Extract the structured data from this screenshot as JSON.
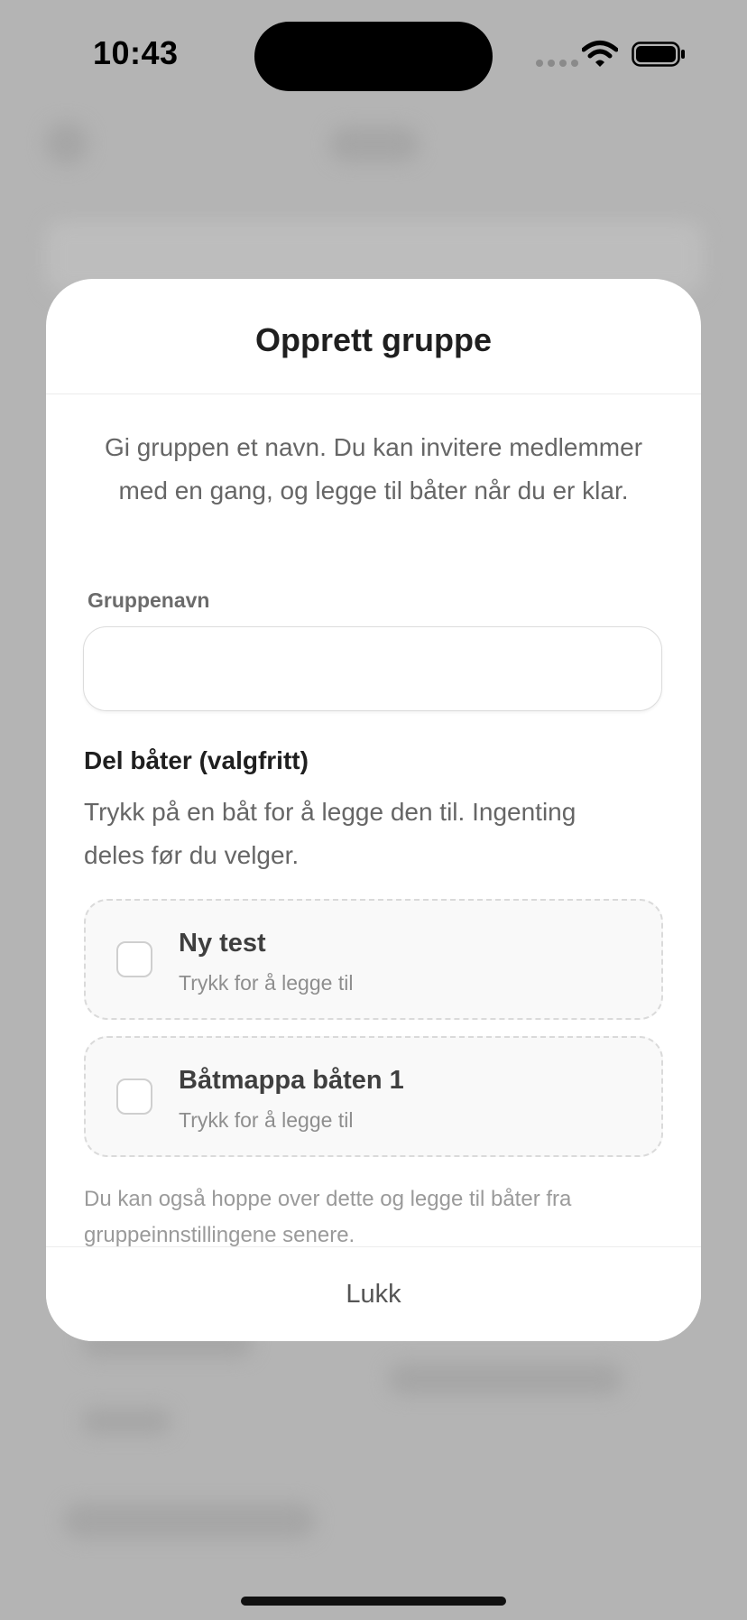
{
  "status_bar": {
    "time": "10:43"
  },
  "modal": {
    "title": "Opprett gruppe",
    "intro": "Gi gruppen et navn. Du kan invitere medlemmer med en gang, og legge til båter når du er klar.",
    "group_name": {
      "label": "Gruppenavn",
      "value": "",
      "placeholder": ""
    },
    "share_boats": {
      "title": "Del båter (valgfritt)",
      "description": "Trykk på en båt for å legge den til. Ingenting deles før du velger.",
      "boats": [
        {
          "name": "Ny test",
          "hint": "Trykk for å legge til",
          "selected": false
        },
        {
          "name": "Båtmappa båten 1",
          "hint": "Trykk for å legge til",
          "selected": false
        }
      ]
    },
    "skip_note": "Du kan også hoppe over dette og legge til båter fra gruppeinnstillingene senere.",
    "close_label": "Lukk"
  }
}
